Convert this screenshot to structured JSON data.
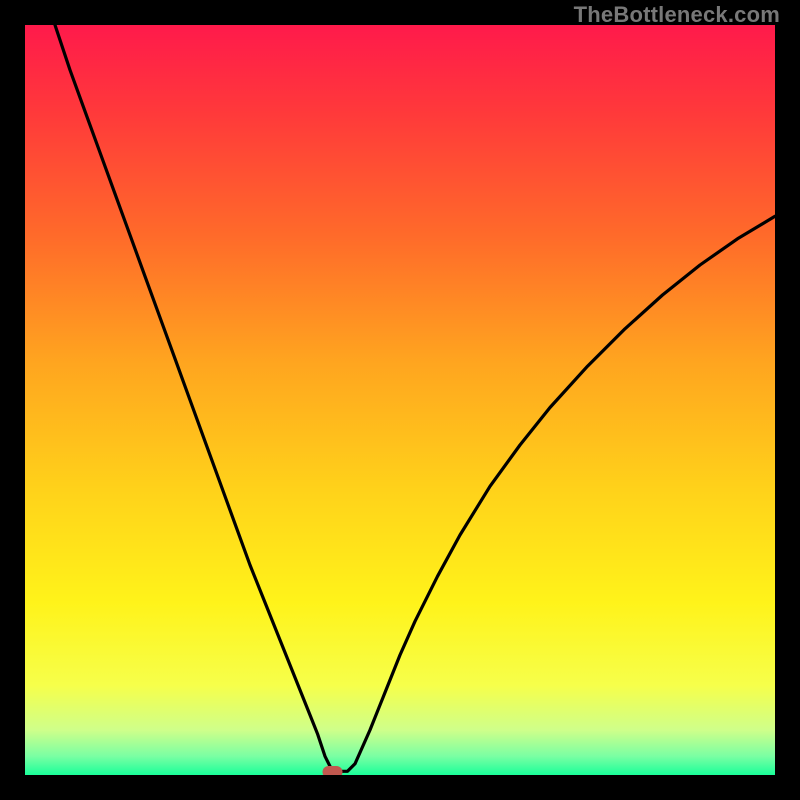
{
  "watermark": "TheBottleneck.com",
  "colors": {
    "frame": "#000000",
    "watermark_text": "#787878",
    "curve": "#000000",
    "marker_fill": "#c1584f",
    "gradient_stops": [
      {
        "offset": 0.0,
        "color": "#ff1a4b"
      },
      {
        "offset": 0.12,
        "color": "#ff3a3a"
      },
      {
        "offset": 0.28,
        "color": "#ff6a2a"
      },
      {
        "offset": 0.45,
        "color": "#ffa51f"
      },
      {
        "offset": 0.62,
        "color": "#ffd21a"
      },
      {
        "offset": 0.77,
        "color": "#fff31a"
      },
      {
        "offset": 0.88,
        "color": "#f6ff4a"
      },
      {
        "offset": 0.94,
        "color": "#cfff8a"
      },
      {
        "offset": 0.975,
        "color": "#7affa3"
      },
      {
        "offset": 1.0,
        "color": "#1aff9a"
      }
    ]
  },
  "chart_data": {
    "type": "line",
    "title": "",
    "xlabel": "",
    "ylabel": "",
    "xlim": [
      0,
      100
    ],
    "ylim": [
      0,
      100
    ],
    "marker": {
      "x": 41,
      "y": 0
    },
    "series": [
      {
        "name": "curve",
        "x": [
          4,
          6,
          8,
          10,
          12,
          14,
          16,
          18,
          20,
          22,
          24,
          26,
          28,
          30,
          32,
          34,
          36,
          38,
          39,
          40,
          41,
          42,
          43,
          44,
          46,
          48,
          50,
          52,
          55,
          58,
          62,
          66,
          70,
          75,
          80,
          85,
          90,
          95,
          100
        ],
        "values": [
          100,
          94,
          88.5,
          83,
          77.5,
          72,
          66.5,
          61,
          55.5,
          50,
          44.5,
          39,
          33.5,
          28,
          23,
          18,
          13,
          8,
          5.5,
          2.5,
          0.5,
          0.5,
          0.5,
          1.5,
          6,
          11,
          16,
          20.5,
          26.5,
          32,
          38.5,
          44,
          49,
          54.5,
          59.5,
          64,
          68,
          71.5,
          74.5
        ]
      }
    ]
  }
}
